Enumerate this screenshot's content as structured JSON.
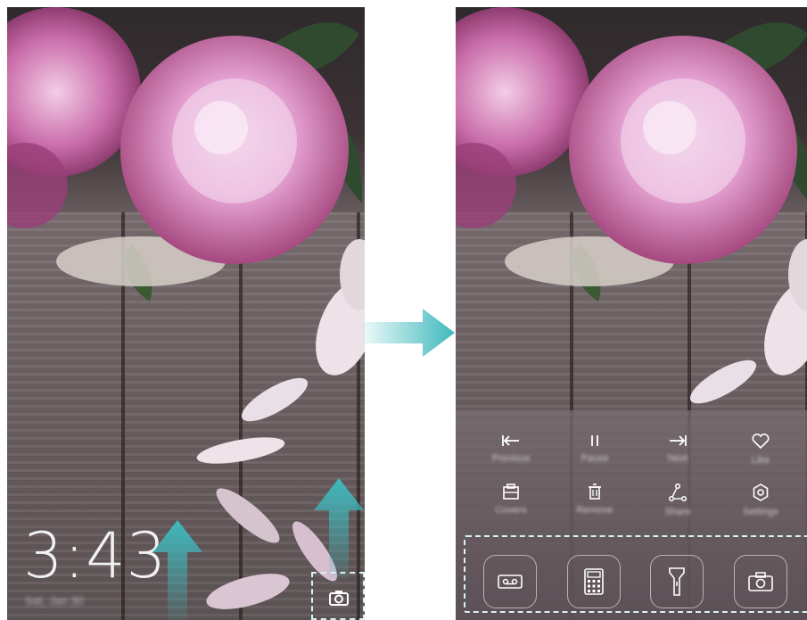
{
  "left_screen": {
    "clock": {
      "time": "3:43"
    },
    "date": "Sat, Jan 30",
    "camera_shortcut": {
      "icon": "camera-icon"
    }
  },
  "right_screen": {
    "music_controls": [
      {
        "label": "Previous",
        "icon": "previous-track-icon"
      },
      {
        "label": "Pause",
        "icon": "pause-icon"
      },
      {
        "label": "Next",
        "icon": "next-track-icon"
      },
      {
        "label": "Like",
        "icon": "heart-icon"
      }
    ],
    "quick_actions": [
      {
        "label": "Covers",
        "icon": "covers-icon"
      },
      {
        "label": "Remove",
        "icon": "trash-icon"
      },
      {
        "label": "Share",
        "icon": "share-icon"
      },
      {
        "label": "Settings",
        "icon": "gear-icon"
      }
    ],
    "shortcuts": [
      {
        "name": "Recorder",
        "icon": "recorder-icon"
      },
      {
        "name": "Calculator",
        "icon": "calculator-icon"
      },
      {
        "name": "Flashlight",
        "icon": "flashlight-icon"
      },
      {
        "name": "Camera",
        "icon": "camera-icon"
      }
    ]
  },
  "colors": {
    "accent_arrow": "#3fb9bd",
    "dashed_highlight": "#d8f2f4",
    "petal_pink": "#d98cc4"
  }
}
